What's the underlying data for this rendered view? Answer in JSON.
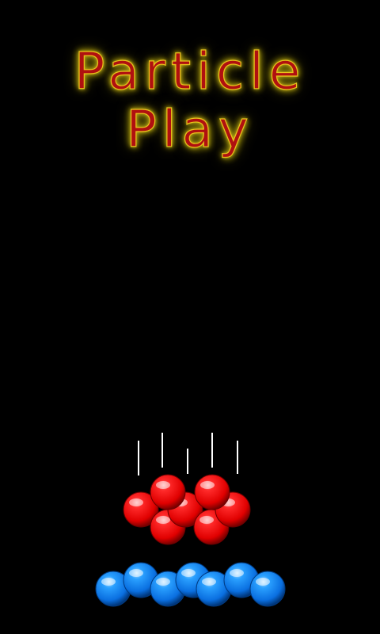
{
  "title": {
    "line1": "Particle",
    "line2": "Play"
  },
  "colors": {
    "background": "#000000",
    "title_fill": "#b01010",
    "title_glow": "#e8c21a",
    "red_ball": "#ff1010",
    "blue_ball": "#1a8cff",
    "streak": "#ffffff"
  },
  "icons": {
    "red_ball": "red-ball-icon",
    "blue_ball": "blue-ball-icon",
    "streak": "falling-streak-icon"
  }
}
